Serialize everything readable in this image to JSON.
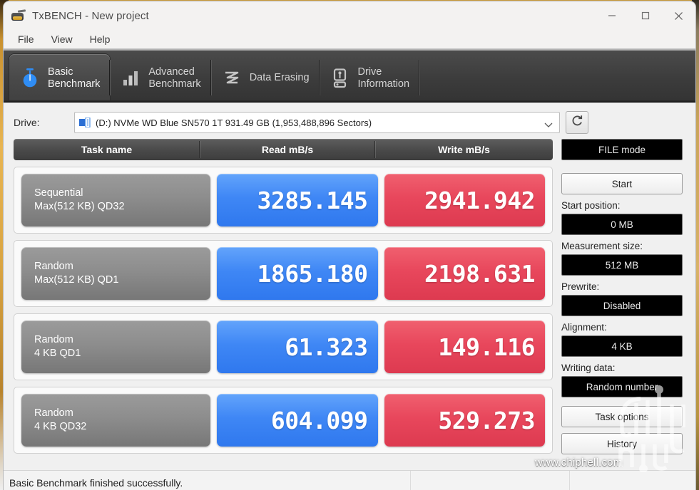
{
  "window": {
    "title": "TxBENCH - New project",
    "app_icon": "txbench-icon",
    "controls": {
      "minimize": "minimize-icon",
      "maximize": "maximize-icon",
      "close": "close-icon"
    }
  },
  "menu": {
    "items": [
      "File",
      "View",
      "Help"
    ]
  },
  "tabs": [
    {
      "label_line1": "Basic",
      "label_line2": "Benchmark",
      "icon": "stopwatch-icon",
      "active": true
    },
    {
      "label_line1": "Advanced",
      "label_line2": "Benchmark",
      "icon": "bar-chart-icon",
      "active": false
    },
    {
      "label_line1": "Data Erasing",
      "label_line2": "",
      "icon": "eraser-wave-icon",
      "active": false
    },
    {
      "label_line1": "Drive",
      "label_line2": "Information",
      "icon": "drive-icon",
      "active": false
    }
  ],
  "drive": {
    "label": "Drive:",
    "selected": "(D:) NVMe WD Blue SN570 1T  931.49 GB (1,953,488,896 Sectors)",
    "refresh_icon": "refresh-icon",
    "caret_icon": "chevron-down-icon"
  },
  "table": {
    "headers": [
      "Task name",
      "Read mB/s",
      "Write mB/s"
    ],
    "rows": [
      {
        "task_line1": "Sequential",
        "task_line2": "Max(512 KB) QD32",
        "read": "3285.145",
        "write": "2941.942"
      },
      {
        "task_line1": "Random",
        "task_line2": "Max(512 KB) QD1",
        "read": "1865.180",
        "write": "2198.631"
      },
      {
        "task_line1": "Random",
        "task_line2": "4 KB QD1",
        "read": "61.323",
        "write": "149.116"
      },
      {
        "task_line1": "Random",
        "task_line2": "4 KB QD32",
        "read": "604.099",
        "write": "529.273"
      }
    ]
  },
  "sidebar": {
    "mode_button": "FILE mode",
    "start_button": "Start",
    "start_position_label": "Start position:",
    "start_position_value": "0 MB",
    "measurement_size_label": "Measurement size:",
    "measurement_size_value": "512 MB",
    "prewrite_label": "Prewrite:",
    "prewrite_value": "Disabled",
    "alignment_label": "Alignment:",
    "alignment_value": "4 KB",
    "writing_data_label": "Writing data:",
    "writing_data_value": "Random number",
    "task_options_button": "Task options",
    "history_button": "History"
  },
  "statusbar": {
    "message": "Basic Benchmark finished successfully."
  },
  "watermark": {
    "text": "www.chiphell.com",
    "logo": "chiphell-logo"
  },
  "colors": {
    "read_chip": "#3f87f5",
    "write_chip": "#e8475c",
    "task_chip": "#8d8d8d",
    "header_bar": "#4a4a4a",
    "tab_strip": "#3c3c3c",
    "value_field": "#000000"
  }
}
